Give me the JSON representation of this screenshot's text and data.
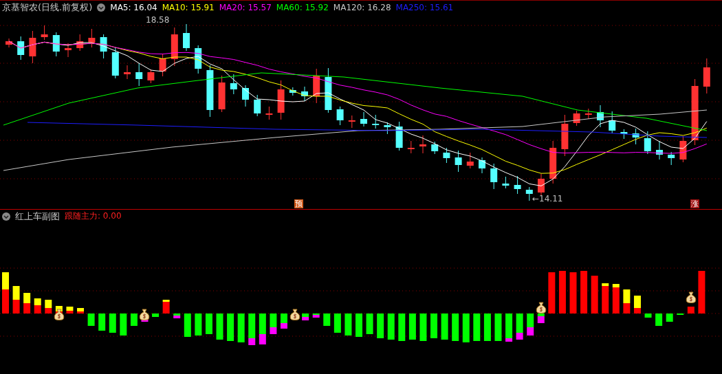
{
  "main_chart": {
    "title": "京基智农(日线.前复权)",
    "indicators": [
      {
        "label": "MA5: 16.04",
        "color": "#ffffff"
      },
      {
        "label": "MA10: 15.91",
        "color": "#ffff00"
      },
      {
        "label": "MA20: 15.57",
        "color": "#ff00ff"
      },
      {
        "label": "MA60: 15.92",
        "color": "#00ff00"
      },
      {
        "label": "MA120: 16.28",
        "color": "#c8c8c8"
      },
      {
        "label": "MA250: 15.61",
        "color": "#1e1eff"
      }
    ],
    "price_labels": [
      {
        "text": "18.58"
      },
      {
        "text": "←14.11"
      }
    ],
    "markers": [
      {
        "text": "预",
        "color": "#d05a1a"
      },
      {
        "text": "涨",
        "color": "#a01010"
      }
    ]
  },
  "sub_chart": {
    "title": "红上车副图",
    "indicator": "跟随主力: 0.00"
  }
}
